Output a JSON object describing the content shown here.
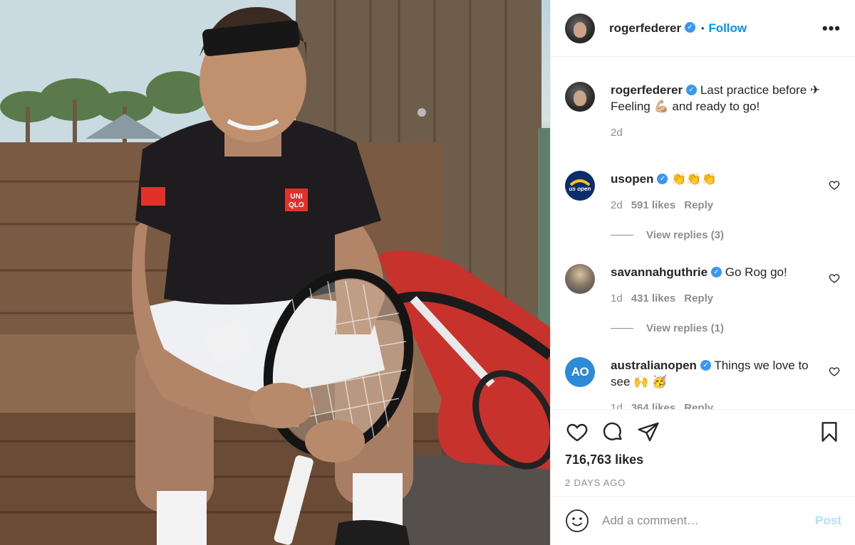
{
  "photo": {
    "shirt_logo": "UNI\nQLO",
    "sleeve_logo": "UNI QLO"
  },
  "header": {
    "username": "rogerfederer",
    "separator": "•",
    "follow_label": "Follow",
    "more_label": "•••"
  },
  "caption": {
    "username": "rogerfederer",
    "text": "Last practice before ✈ Feeling 💪🏼 and ready to go!",
    "time": "2d"
  },
  "comments": [
    {
      "username": "usopen",
      "avatar_text": "us open",
      "text": "👏👏👏",
      "time": "2d",
      "likes": "591 likes",
      "reply_label": "Reply",
      "view_replies": "View replies (3)"
    },
    {
      "username": "savannahguthrie",
      "text": "Go Rog go!",
      "time": "1d",
      "likes": "431 likes",
      "reply_label": "Reply",
      "view_replies": "View replies (1)"
    },
    {
      "username": "australianopen",
      "avatar_text": "AO",
      "text": "Things we love to see 🙌 🥳",
      "time": "1d",
      "likes": "364 likes",
      "reply_label": "Reply"
    }
  ],
  "actions": {
    "like_count": "716,763 likes",
    "posted_ago": "2 DAYS AGO",
    "icons": [
      "heart-icon",
      "comment-icon",
      "share-icon",
      "bookmark-icon"
    ]
  },
  "add_comment": {
    "placeholder": "Add a comment…",
    "post_label": "Post"
  },
  "colors": {
    "link_blue": "#0095f6",
    "verified_blue": "#3897f0",
    "muted": "#8e8e8e",
    "post_disabled": "#b2dffc"
  }
}
